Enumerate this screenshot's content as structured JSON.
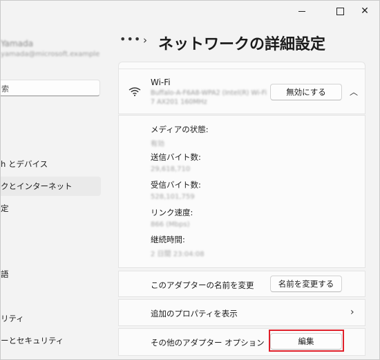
{
  "window": {
    "minimize_glyph": "",
    "maximize_glyph": "",
    "close_glyph": "✕"
  },
  "sidebar": {
    "profile_name": "Yamada",
    "profile_email": "yamada@microsoft.example",
    "search_placeholder": "索",
    "items": [
      {
        "label": "h とデバイス"
      },
      {
        "label": "クとインターネット"
      },
      {
        "label": "定"
      },
      {
        "label": "語"
      },
      {
        "label": "リティ"
      },
      {
        "label": "ーとセキュリティ"
      }
    ]
  },
  "header": {
    "more_label": "•••",
    "separator": "›",
    "title": "ネットワークの詳細設定"
  },
  "wifi": {
    "title": "Wi-Fi",
    "subtitle_1": "Buffalo-A-F6A8-WPA2 (Intel(R) Wi-Fi",
    "subtitle_2": "7 AX201 160MHz",
    "disable_button": "無効にする",
    "icon": "wifi-icon"
  },
  "details": [
    {
      "label": "メディアの状態:",
      "value": "有効"
    },
    {
      "label": "送信バイト数:",
      "value": "29,618,710"
    },
    {
      "label": "受信バイト数:",
      "value": "528,101,759"
    },
    {
      "label": "リンク速度:",
      "value": "866 (Mbps)"
    },
    {
      "label": "継続時間:",
      "value": "2 日間 23:04:08"
    }
  ],
  "rename": {
    "label": "このアダプターの名前を変更",
    "button": "名前を変更する"
  },
  "properties": {
    "label": "追加のプロパティを表示"
  },
  "options": {
    "label": "その他のアダプター オプション",
    "button": "編集"
  },
  "colors": {
    "highlight": "#e0202a",
    "background": "#f3f3f3",
    "card": "#fbfbfb"
  }
}
